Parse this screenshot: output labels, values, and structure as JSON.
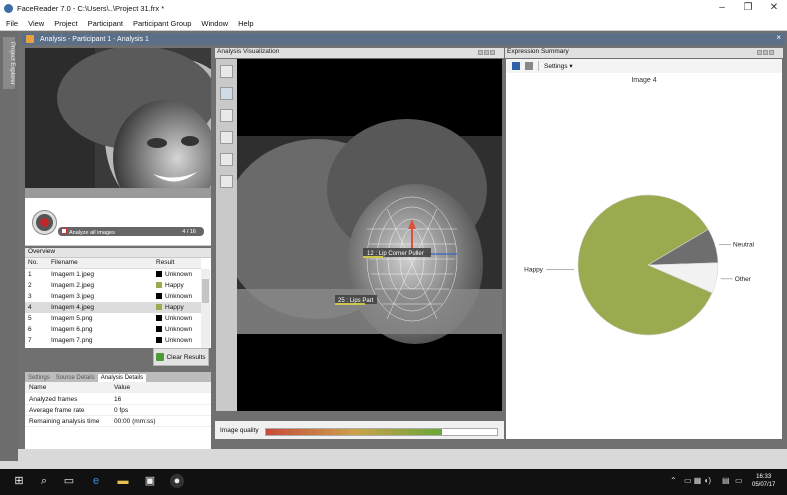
{
  "window": {
    "title": "FaceReader 7.0 - C:\\Users\\..\\Project 31.frx *",
    "minimize": "–",
    "maximize": "❐",
    "close": "✕"
  },
  "menu": [
    "File",
    "View",
    "Project",
    "Participant",
    "Participant Group",
    "Window",
    "Help"
  ],
  "side_tab": "Project Explorer",
  "analysis_window": {
    "title": "Analysis - Participant 1 - Analysis 1",
    "close": "×"
  },
  "player": {
    "analyze_all_label": "Analyze all images",
    "counter": "4 / 16"
  },
  "overview": {
    "title": "Overview",
    "columns": [
      "No.",
      "Filename",
      "Result"
    ],
    "rows": [
      {
        "no": "1",
        "file": "Imagem 1.jpeg",
        "result": "Unknown",
        "color": "#000000"
      },
      {
        "no": "2",
        "file": "Imagem 2.jpeg",
        "result": "Happy",
        "color": "#9aab4f"
      },
      {
        "no": "3",
        "file": "Imagem 3.jpeg",
        "result": "Unknown",
        "color": "#000000"
      },
      {
        "no": "4",
        "file": "Imagem 4.jpeg",
        "result": "Happy",
        "color": "#9aab4f"
      },
      {
        "no": "5",
        "file": "Imagem 5.png",
        "result": "Unknown",
        "color": "#000000"
      },
      {
        "no": "6",
        "file": "Imagem 6.png",
        "result": "Unknown",
        "color": "#000000"
      },
      {
        "no": "7",
        "file": "Imagem 7.png",
        "result": "Unknown",
        "color": "#000000"
      }
    ],
    "selected_index": 3,
    "clear_results": "Clear Results"
  },
  "details": {
    "tabs": [
      "Settings",
      "Source Details",
      "Analysis Details"
    ],
    "active_tab": 2,
    "columns": [
      "Name",
      "Value"
    ],
    "rows": [
      {
        "name": "Analyzed frames",
        "value": "16"
      },
      {
        "name": "Average frame rate",
        "value": "0 fps"
      },
      {
        "name": "Remaining analysis time",
        "value": "00:00 (mm:ss)"
      }
    ]
  },
  "visualization": {
    "title": "Analysis Visualization",
    "label_au12": "12 : Lip Corner Puller",
    "label_au25": "25 : Lips Part",
    "quality_label": "Image quality",
    "quality_fraction": 0.76
  },
  "expression_summary": {
    "title": "Expression Summary",
    "settings_label": "Settings",
    "settings_caret": "▾"
  },
  "chart_data": {
    "type": "pie",
    "title": "Image 4",
    "slices": [
      {
        "label": "Happy",
        "value": 0.85,
        "color": "#9aab4f"
      },
      {
        "label": "Neutral",
        "value": 0.08,
        "color": "#6e6e6e"
      },
      {
        "label": "Other",
        "value": 0.07,
        "color": "#f2f2f2"
      }
    ]
  },
  "taskbar": {
    "time": "16:33",
    "date": "05/07/17"
  }
}
